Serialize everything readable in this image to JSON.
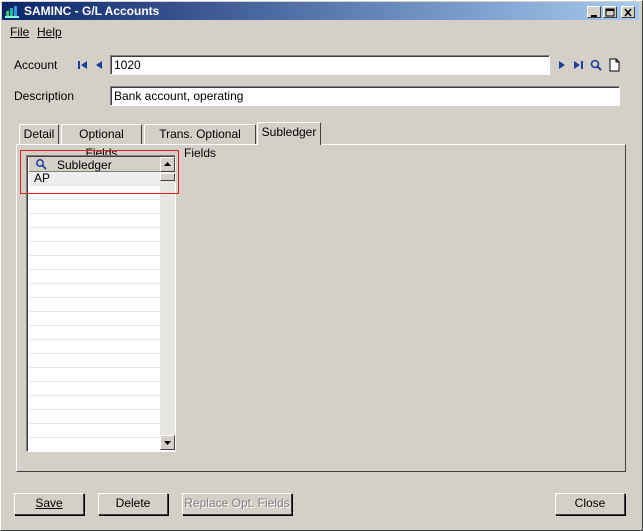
{
  "window": {
    "title": "SAMINC - G/L Accounts",
    "controls": [
      "minimize",
      "maximize",
      "close"
    ]
  },
  "menu": {
    "items": [
      {
        "label": "File"
      },
      {
        "label": "Help"
      }
    ]
  },
  "form": {
    "account_label": "Account",
    "account_value": "1020",
    "description_label": "Description",
    "description_value": "Bank account, operating"
  },
  "tabs": [
    {
      "label": "Detail"
    },
    {
      "label": "Optional Fields"
    },
    {
      "label": "Trans. Optional Fields"
    },
    {
      "label": "Subledger",
      "active": true
    }
  ],
  "grid": {
    "column": "Subledger",
    "rows": [
      "AP"
    ]
  },
  "buttons": {
    "save": "Save",
    "delete": "Delete",
    "replace": "Replace Opt. Fields",
    "close": "Close"
  },
  "colors": {
    "titlebar_start": "#0a246a",
    "titlebar_end": "#a6caf0",
    "highlight": "#e02020",
    "nav_icon": "#1c3f9e"
  },
  "icons": [
    "app-icon",
    "first-record-icon",
    "previous-record-icon",
    "next-record-icon",
    "last-record-icon",
    "finder-icon",
    "new-document-icon",
    "grid-search-icon",
    "scroll-up-icon",
    "scroll-down-icon"
  ]
}
